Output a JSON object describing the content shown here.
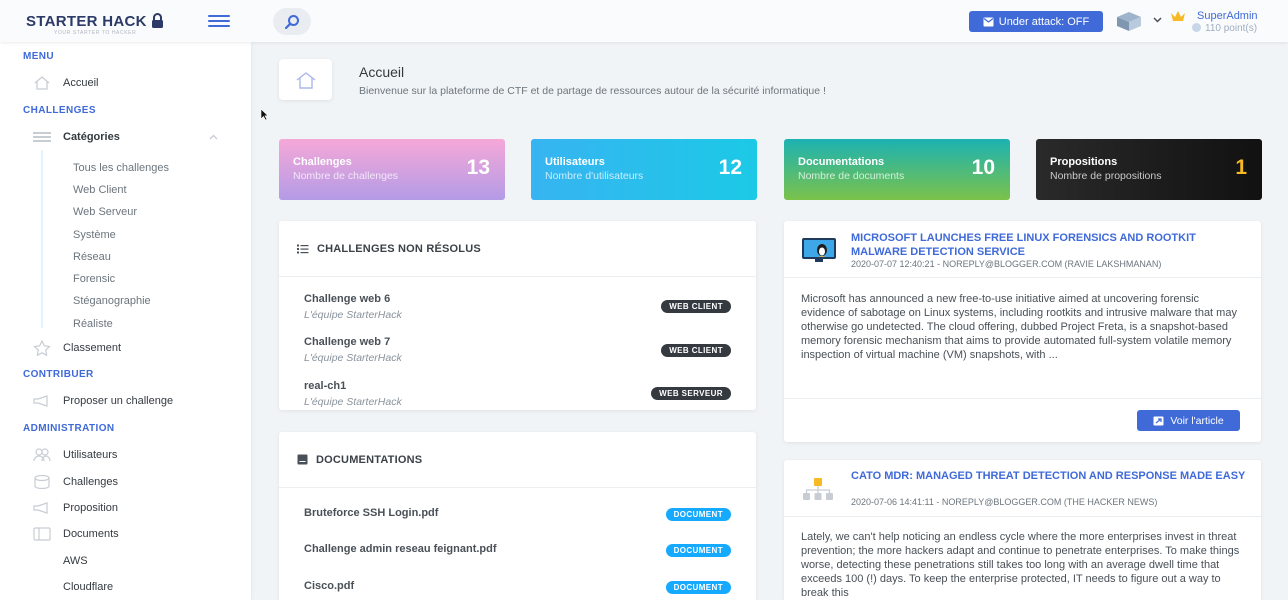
{
  "header": {
    "logo": "STARTER HACK",
    "logo_tagline": "YOUR STARTER TO HACKER",
    "attack_button": "Under attack: OFF",
    "user_name": "SuperAdmin",
    "user_points": "110 point(s)"
  },
  "sidebar": {
    "menu_head": "MENU",
    "accueil": "Accueil",
    "challenges_head": "CHALLENGES",
    "categories": "Catégories",
    "sub_items": [
      "Tous les challenges",
      "Web Client",
      "Web Serveur",
      "Système",
      "Réseau",
      "Forensic",
      "Stéganographie",
      "Réaliste"
    ],
    "classement": "Classement",
    "contribuer_head": "CONTRIBUER",
    "proposer": "Proposer un challenge",
    "admin_head": "ADMINISTRATION",
    "utilisateurs": "Utilisateurs",
    "challenges": "Challenges",
    "proposition": "Proposition",
    "documents": "Documents",
    "aws": "AWS",
    "cloudflare": "Cloudflare"
  },
  "page": {
    "title": "Accueil",
    "subtitle": "Bienvenue sur la plateforme de CTF et de partage de ressources autour de la sécurité informatique !"
  },
  "stats": [
    {
      "label": "Challenges",
      "sub": "Nombre de challenges",
      "value": "13"
    },
    {
      "label": "Utilisateurs",
      "sub": "Nombre d'utilisateurs",
      "value": "12"
    },
    {
      "label": "Documentations",
      "sub": "Nombre de documents",
      "value": "10"
    },
    {
      "label": "Propositions",
      "sub": "Nombre de propositions",
      "value": "1"
    }
  ],
  "unsolved": {
    "title": "CHALLENGES NON RÉSOLUS",
    "items": [
      {
        "name": "Challenge web 6",
        "author": "L'équipe StarterHack",
        "tag": "WEB CLIENT"
      },
      {
        "name": "Challenge web 7",
        "author": "L'équipe StarterHack",
        "tag": "WEB CLIENT"
      },
      {
        "name": "real-ch1",
        "author": "L'équipe StarterHack",
        "tag": "WEB SERVEUR"
      }
    ]
  },
  "docs": {
    "title": "DOCUMENTATIONS",
    "items": [
      {
        "name": "Bruteforce SSH Login.pdf",
        "tag": "DOCUMENT"
      },
      {
        "name": "Challenge admin reseau feignant.pdf",
        "tag": "DOCUMENT"
      },
      {
        "name": "Cisco.pdf",
        "tag": "DOCUMENT"
      }
    ]
  },
  "news": [
    {
      "title": "MICROSOFT LAUNCHES FREE LINUX FORENSICS AND ROOTKIT MALWARE DETECTION SERVICE",
      "meta": "2020-07-07 12:40:21 - NOREPLY@BLOGGER.COM (RAVIE LAKSHMANAN)",
      "text": "Microsoft has announced a new free-to-use initiative aimed at uncovering forensic evidence of sabotage on Linux systems, including rootkits and intrusive malware that may otherwise go undetected. The cloud offering, dubbed Project Freta, is a snapshot-based memory forensic mechanism that aims to provide automated full-system volatile memory inspection of virtual machine (VM) snapshots, with ...",
      "button": "Voir l'article"
    },
    {
      "title": "CATO MDR: MANAGED THREAT DETECTION AND RESPONSE MADE EASY",
      "meta": "2020-07-06 14:41:11 - NOREPLY@BLOGGER.COM (THE HACKER NEWS)",
      "text": "Lately, we can't help noticing an endless cycle where the more enterprises invest in threat prevention; the more hackers adapt and continue to penetrate enterprises. To make things worse, detecting these penetrations still takes too long with an average dwell time that exceeds 100 (!) days. To keep the enterprise protected, IT needs to figure out a way to break this"
    }
  ],
  "colors": {
    "accent": "#3f6ad8",
    "badge_dark": "#343a40",
    "badge_blue": "#16aaff"
  }
}
